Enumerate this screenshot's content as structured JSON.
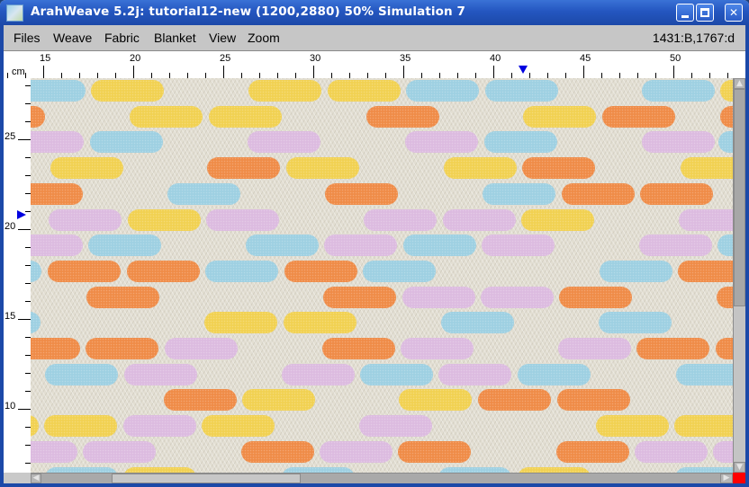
{
  "window": {
    "title": "ArahWeave 5.2j: tutorial12-new (1200,2880) 50% Simulation 7",
    "controls": {
      "minimize": "minimize",
      "maximize": "maximize",
      "close": "✕"
    }
  },
  "menubar": {
    "items": [
      "Files",
      "Weave",
      "Fabric",
      "Blanket",
      "View",
      "Zoom"
    ],
    "coordinates": "1431:B,1767:d"
  },
  "ruler": {
    "unit": "cm",
    "top_labels": [
      "15",
      "20",
      "25",
      "30",
      "35",
      "40",
      "45",
      "50"
    ],
    "left_labels": [
      "25",
      "20",
      "15",
      "10"
    ]
  },
  "colors": {
    "blue": "#9ed0e2",
    "yellow": "#f1d152",
    "orange": "#ef8c48",
    "pink": "#dcbbe0",
    "fabric_ground": "#e2ded2",
    "marker": "#0000e0"
  },
  "fabric": {
    "rows": [
      [
        [
          "blue",
          -20
        ],
        [
          "yellow",
          67
        ],
        [
          "yellow",
          242
        ],
        [
          "yellow",
          330
        ],
        [
          "blue",
          417
        ],
        [
          "blue",
          505
        ],
        [
          "blue",
          679
        ],
        [
          "yellow",
          766
        ]
      ],
      [
        [
          "orange",
          -65
        ],
        [
          "yellow",
          110
        ],
        [
          "yellow",
          198
        ],
        [
          "orange",
          373
        ],
        [
          "yellow",
          547
        ],
        [
          "orange",
          635
        ],
        [
          "orange",
          766
        ]
      ],
      [
        [
          "pink",
          -22
        ],
        [
          "blue",
          66
        ],
        [
          "pink",
          241
        ],
        [
          "pink",
          416
        ],
        [
          "blue",
          504
        ],
        [
          "pink",
          679
        ],
        [
          "blue",
          764
        ]
      ],
      [
        [
          "yellow",
          22
        ],
        [
          "orange",
          196
        ],
        [
          "yellow",
          284
        ],
        [
          "yellow",
          459
        ],
        [
          "orange",
          546
        ],
        [
          "yellow",
          722
        ]
      ],
      [
        [
          "orange",
          -23
        ],
        [
          "blue",
          152
        ],
        [
          "orange",
          327
        ],
        [
          "blue",
          502
        ],
        [
          "orange",
          590
        ],
        [
          "orange",
          677
        ]
      ],
      [
        [
          "pink",
          20
        ],
        [
          "yellow",
          108
        ],
        [
          "pink",
          195
        ],
        [
          "pink",
          370
        ],
        [
          "pink",
          458
        ],
        [
          "yellow",
          545
        ],
        [
          "pink",
          720
        ]
      ],
      [
        [
          "pink",
          -23
        ],
        [
          "blue",
          64
        ],
        [
          "blue",
          239
        ],
        [
          "pink",
          326
        ],
        [
          "blue",
          414
        ],
        [
          "pink",
          501
        ],
        [
          "pink",
          676
        ],
        [
          "blue",
          763
        ]
      ],
      [
        [
          "blue",
          -69
        ],
        [
          "orange",
          19
        ],
        [
          "orange",
          107
        ],
        [
          "blue",
          194
        ],
        [
          "orange",
          282
        ],
        [
          "blue",
          369
        ],
        [
          "blue",
          632
        ],
        [
          "orange",
          719
        ]
      ],
      [
        [
          "orange",
          62
        ],
        [
          "orange",
          325
        ],
        [
          "pink",
          413
        ],
        [
          "pink",
          500
        ],
        [
          "orange",
          587
        ],
        [
          "orange",
          762
        ]
      ],
      [
        [
          "blue",
          -70
        ],
        [
          "yellow",
          193
        ],
        [
          "yellow",
          281
        ],
        [
          "blue",
          456
        ],
        [
          "blue",
          631
        ]
      ],
      [
        [
          "orange",
          -26
        ],
        [
          "orange",
          61
        ],
        [
          "pink",
          149
        ],
        [
          "orange",
          324
        ],
        [
          "pink",
          411
        ],
        [
          "pink",
          586
        ],
        [
          "orange",
          673
        ],
        [
          "orange",
          761
        ]
      ],
      [
        [
          "blue",
          16
        ],
        [
          "pink",
          104
        ],
        [
          "pink",
          279
        ],
        [
          "blue",
          366
        ],
        [
          "pink",
          453
        ],
        [
          "blue",
          541
        ],
        [
          "blue",
          717
        ]
      ],
      [
        [
          "orange",
          148
        ],
        [
          "yellow",
          235
        ],
        [
          "yellow",
          409
        ],
        [
          "orange",
          497
        ],
        [
          "orange",
          585
        ]
      ],
      [
        [
          "yellow",
          -72
        ],
        [
          "yellow",
          15
        ],
        [
          "pink",
          103
        ],
        [
          "yellow",
          190
        ],
        [
          "pink",
          365
        ],
        [
          "yellow",
          628
        ],
        [
          "yellow",
          715
        ]
      ],
      [
        [
          "pink",
          -29
        ],
        [
          "pink",
          58
        ],
        [
          "orange",
          234
        ],
        [
          "pink",
          321
        ],
        [
          "orange",
          408
        ],
        [
          "orange",
          584
        ],
        [
          "pink",
          671
        ],
        [
          "pink",
          758
        ]
      ],
      [
        [
          "blue",
          16
        ],
        [
          "yellow",
          103
        ],
        [
          "blue",
          279
        ],
        [
          "blue",
          453
        ],
        [
          "yellow",
          541
        ],
        [
          "blue",
          716
        ]
      ]
    ]
  },
  "scrollbars": {
    "horizontal_position_fraction": 0.12,
    "vertical_position_fraction": 0.03
  }
}
